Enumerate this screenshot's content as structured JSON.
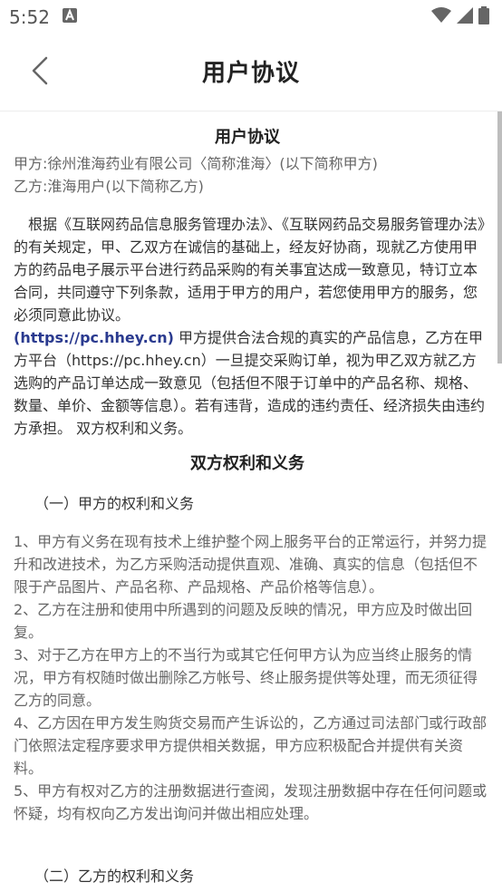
{
  "status_bar": {
    "time": "5:52"
  },
  "header": {
    "title": "用户协议"
  },
  "doc": {
    "title": "用户协议",
    "party_a": "甲方:徐州淮海药业有限公司〈简称淮海〉(以下简称甲方)",
    "party_b": "乙方:淮海用户(以下简称乙方)",
    "intro": "　根据《互联网药品信息服务管理办法》、《互联网药品交易服务管理办法》的有关规定，甲、乙双方在诚信的基础上，经友好协商，现就乙方使用甲方的药品电子展示平台进行药品采购的有关事宜达成一致意见，特订立本合同，共同遵守下列条款，适用于甲方的用户，若您使用甲方的服务，您必须同意此协议。",
    "link_text": "(https://pc.hhey.cn)",
    "intro2": " 甲方提供合法合规的真实的产品信息，乙方在甲方平台（https://pc.hhey.cn）一旦提交采购订单，视为甲乙双方就乙方选购的产品订单达成一致意见（包括但不限于订单中的产品名称、规格、数量、单价、金额等信息）。若有违背，造成的违约责任、经济损失由违约方承担。 双方权利和义务。",
    "section_title": "双方权利和义务",
    "sub_a": "（一）甲方的权利和义务",
    "items_a": [
      "1、甲方有义务在现有技术上维护整个网上服务平台的正常运行，并努力提升和改进技术，为乙方采购活动提供直观、准确、真实的信息（包括但不限于产品图片、产品名称、产品规格、产品价格等信息）。",
      "2、乙方在注册和使用中所遇到的问题及反映的情况，甲方应及时做出回复。",
      "3、对于乙方在甲方上的不当行为或其它任何甲方认为应当终止服务的情况，甲方有权随时做出删除乙方帐号、终止服务提供等处理，而无须征得乙方的同意。",
      "4、乙方因在甲方发生购货交易而产生诉讼的，乙方通过司法部门或行政部门依照法定程序要求甲方提供相关数据，甲方应积极配合并提供有关资料。",
      "5、甲方有权对乙方的注册数据进行查阅，发现注册数据中存在任何问题或怀疑，均有权向乙方发出询问并做出相应处理。"
    ],
    "sub_b": "（二）乙方的权利和义务"
  }
}
